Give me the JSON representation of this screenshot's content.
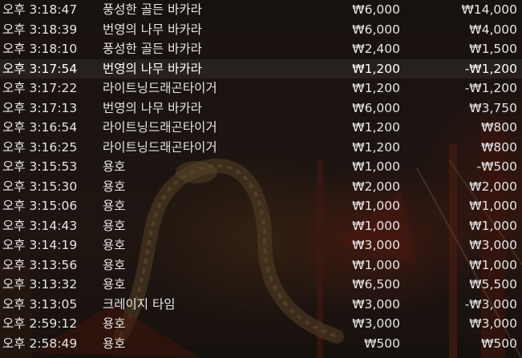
{
  "history": {
    "rows": [
      {
        "time": "오후 3:18:47",
        "game": "풍성한 골든 바카라",
        "bet": "₩6,000",
        "payout": "₩14,000",
        "highlight": false
      },
      {
        "time": "오후 3:18:39",
        "game": "번영의 나무 바카라",
        "bet": "₩6,000",
        "payout": "₩4,000",
        "highlight": false
      },
      {
        "time": "오후 3:18:10",
        "game": "풍성한 골든 바카라",
        "bet": "₩2,400",
        "payout": "₩1,500",
        "highlight": false
      },
      {
        "time": "오후 3:17:54",
        "game": "번영의 나무 바카라",
        "bet": "₩1,200",
        "payout": "-₩1,200",
        "highlight": true
      },
      {
        "time": "오후 3:17:22",
        "game": "라이트닝드래곤타이거",
        "bet": "₩1,200",
        "payout": "-₩1,200",
        "highlight": false
      },
      {
        "time": "오후 3:17:13",
        "game": "번영의 나무 바카라",
        "bet": "₩6,000",
        "payout": "₩3,750",
        "highlight": false
      },
      {
        "time": "오후 3:16:54",
        "game": "라이트닝드래곤타이거",
        "bet": "₩1,200",
        "payout": "₩800",
        "highlight": false
      },
      {
        "time": "오후 3:16:25",
        "game": "라이트닝드래곤타이거",
        "bet": "₩1,200",
        "payout": "₩800",
        "highlight": false
      },
      {
        "time": "오후 3:15:53",
        "game": "용호",
        "bet": "₩1,000",
        "payout": "-₩500",
        "highlight": false
      },
      {
        "time": "오후 3:15:30",
        "game": "용호",
        "bet": "₩2,000",
        "payout": "₩2,000",
        "highlight": false
      },
      {
        "time": "오후 3:15:06",
        "game": "용호",
        "bet": "₩1,000",
        "payout": "₩1,000",
        "highlight": false
      },
      {
        "time": "오후 3:14:43",
        "game": "용호",
        "bet": "₩1,000",
        "payout": "₩1,000",
        "highlight": false
      },
      {
        "time": "오후 3:14:19",
        "game": "용호",
        "bet": "₩3,000",
        "payout": "₩3,000",
        "highlight": false
      },
      {
        "time": "오후 3:13:56",
        "game": "용호",
        "bet": "₩1,000",
        "payout": "₩1,000",
        "highlight": false
      },
      {
        "time": "오후 3:13:32",
        "game": "용호",
        "bet": "₩6,500",
        "payout": "₩5,500",
        "highlight": false
      },
      {
        "time": "오후 3:13:05",
        "game": "크레이지 타임",
        "bet": "₩3,000",
        "payout": "-₩3,000",
        "highlight": false
      },
      {
        "time": "오후 2:59:12",
        "game": "용호",
        "bet": "₩3,000",
        "payout": "₩3,000",
        "highlight": false
      },
      {
        "time": "오후 2:58:49",
        "game": "용호",
        "bet": "₩500",
        "payout": "₩500",
        "highlight": false
      }
    ]
  }
}
